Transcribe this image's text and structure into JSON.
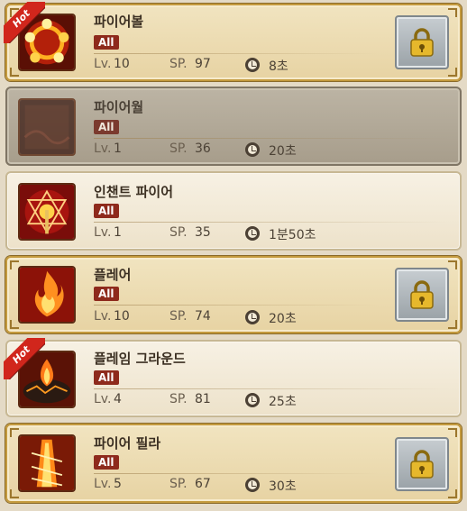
{
  "labels": {
    "level_prefix": "Lv.",
    "sp_prefix": "SP."
  },
  "colors": {
    "gold_frame": "#c49a3e",
    "tag_red": "#8e2a1c",
    "hot_red": "#d1261c"
  },
  "skills": [
    {
      "name": "파이어볼",
      "tag": "All",
      "level": "10",
      "sp": "97",
      "cooldown": "8초",
      "hot": "Hot",
      "style": "gold",
      "locked": true,
      "icon": "fireball-icon"
    },
    {
      "name": "파이어월",
      "tag": "All",
      "level": "1",
      "sp": "36",
      "cooldown": "20초",
      "style": "dim",
      "locked": false,
      "icon": "firewall-icon"
    },
    {
      "name": "인챈트 파이어",
      "tag": "All",
      "level": "1",
      "sp": "35",
      "cooldown": "1분50초",
      "style": "plain",
      "locked": false,
      "icon": "enchant-fire-icon"
    },
    {
      "name": "플레어",
      "tag": "All",
      "level": "10",
      "sp": "74",
      "cooldown": "20초",
      "style": "gold",
      "locked": true,
      "icon": "flare-icon"
    },
    {
      "name": "플레임 그라운드",
      "tag": "All",
      "level": "4",
      "sp": "81",
      "cooldown": "25초",
      "hot": "Hot",
      "style": "plain",
      "locked": false,
      "icon": "flame-ground-icon"
    },
    {
      "name": "파이어 필라",
      "tag": "All",
      "level": "5",
      "sp": "67",
      "cooldown": "30초",
      "style": "gold",
      "locked": true,
      "icon": "fire-pillar-icon"
    }
  ]
}
